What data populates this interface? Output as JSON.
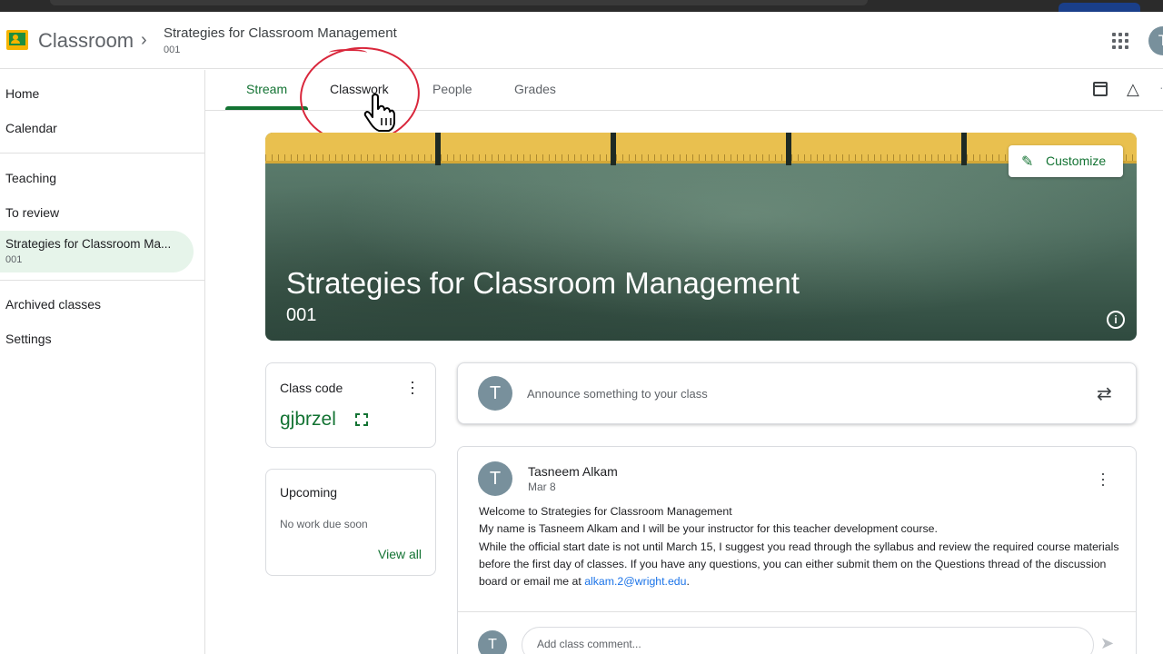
{
  "app": {
    "name": "Classroom",
    "breadcrumb_separator": "›",
    "course_title": "Strategies for Classroom Management",
    "course_section": "001",
    "avatar_letter": "T"
  },
  "sidebar": {
    "items": [
      {
        "label": "Home"
      },
      {
        "label": "Calendar"
      },
      {
        "label": "Teaching"
      },
      {
        "label": "To review"
      },
      {
        "label": "Archived classes"
      },
      {
        "label": "Settings"
      }
    ],
    "active_course": {
      "title": "Strategies for Classroom Ma...",
      "section": "001"
    }
  },
  "tabs": [
    {
      "label": "Stream",
      "active": true
    },
    {
      "label": "Classwork"
    },
    {
      "label": "People"
    },
    {
      "label": "Grades"
    }
  ],
  "banner": {
    "title": "Strategies for Classroom Management",
    "section": "001",
    "customize_label": "Customize",
    "info_glyph": "i"
  },
  "class_code": {
    "label": "Class code",
    "code": "gjbrzel"
  },
  "upcoming": {
    "title": "Upcoming",
    "empty_text": "No work due soon",
    "view_all": "View all"
  },
  "announce": {
    "avatar_letter": "T",
    "placeholder": "Announce something to your class"
  },
  "post": {
    "avatar_letter": "T",
    "author": "Tasneem Alkam",
    "date": "Mar 8",
    "line1": "Welcome to Strategies for Classroom Management",
    "line2": "My name is Tasneem Alkam and I will be your instructor for this teacher development course.",
    "line3": "While the official start date is not until March 15, I suggest you read through the syllabus and review the required course materials before the first day of classes. If you have any questions, you can either submit them on the Questions thread of the discussion board or email me at ",
    "email": "alkam.2@wright.edu",
    "line3_end": ".",
    "comment_placeholder": "Add class comment..."
  },
  "colors": {
    "accent_green": "#137333",
    "annotation_red": "#d9263b",
    "avatar_gray": "#78909c",
    "ruler_yellow": "#e9c04f"
  },
  "icons": [
    "classroom-logo-icon",
    "apps-grid-icon",
    "calendar-icon",
    "drive-icon",
    "pencil-icon",
    "info-icon",
    "more-vert-icon",
    "expand-icon",
    "repost-icon",
    "send-icon",
    "hand-cursor-icon"
  ]
}
